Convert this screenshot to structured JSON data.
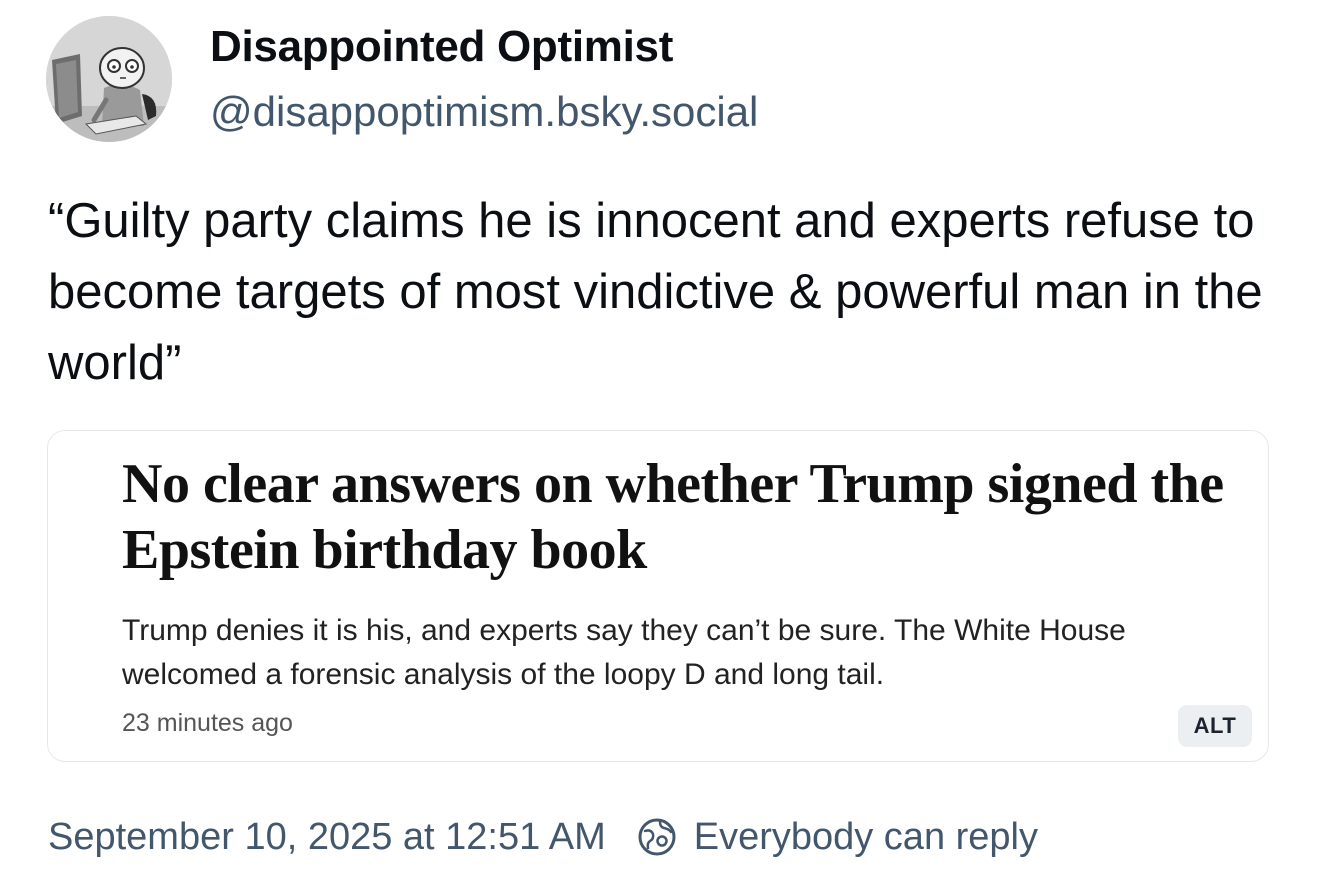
{
  "author": {
    "display_name": "Disappointed Optimist",
    "handle": "@disappoptimism.bsky.social",
    "avatar_icon": "cartoon-person-at-computer-avatar"
  },
  "post": {
    "text": "“Guilty party claims he is innocent and experts refuse to become targets of most vindictive & powerful man in the world”"
  },
  "embed": {
    "headline": "No clear answers on whether Trump signed the Epstein birthday book",
    "subheadline": "Trump denies it is his, and experts say they can’t be sure. The White House welcomed a forensic analysis of the loopy D and long tail.",
    "time_ago": "23 minutes ago",
    "alt_label": "ALT"
  },
  "footer": {
    "date": "September 10, 2025 at 12:51 AM",
    "reply_icon": "everybody-can-reply-icon",
    "reply_setting": "Everybody can reply"
  },
  "colors": {
    "text": "#0b0f14",
    "muted": "#42576c",
    "card_border": "#e6e9ec",
    "alt_badge_bg": "#eceff2"
  }
}
